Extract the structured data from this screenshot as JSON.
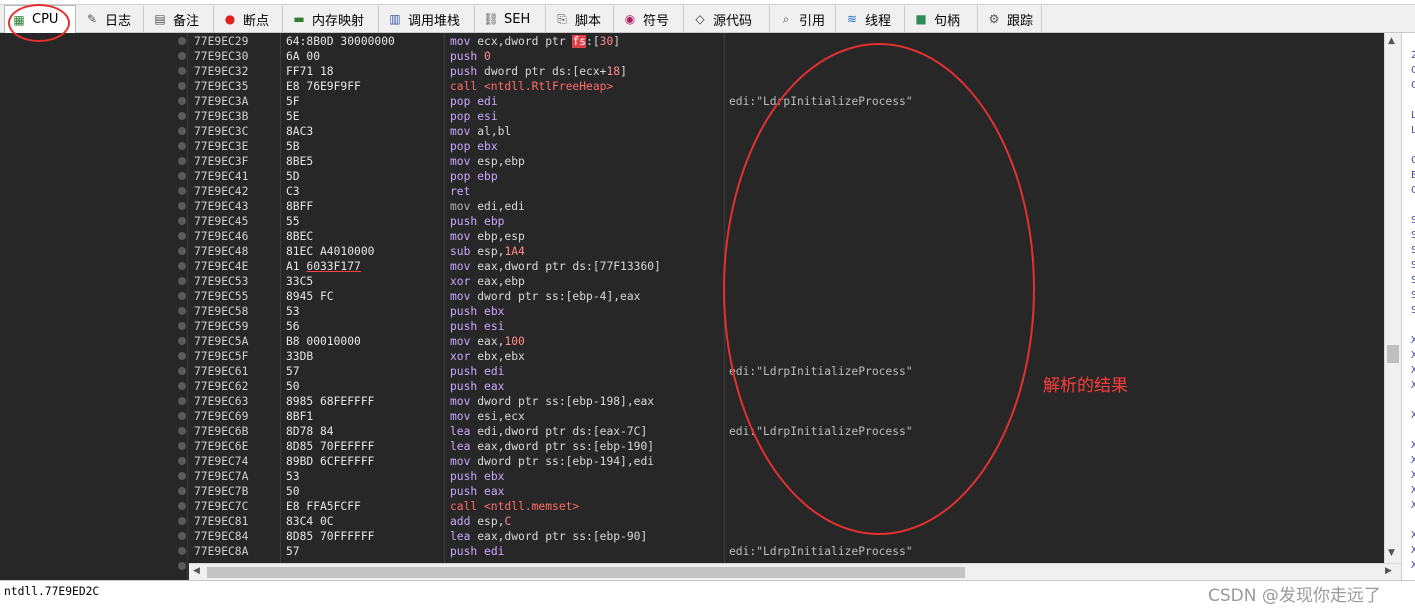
{
  "tabs": [
    {
      "label": "CPU",
      "icon": "cpu-icon",
      "active": true
    },
    {
      "label": "日志",
      "icon": "log-icon"
    },
    {
      "label": "备注",
      "icon": "notes-icon"
    },
    {
      "label": "断点",
      "icon": "breakpoint-icon"
    },
    {
      "label": "内存映射",
      "icon": "memory-map-icon"
    },
    {
      "label": "调用堆栈",
      "icon": "call-stack-icon"
    },
    {
      "label": "SEH",
      "icon": "seh-icon"
    },
    {
      "label": "脚本",
      "icon": "script-icon"
    },
    {
      "label": "符号",
      "icon": "symbols-icon"
    },
    {
      "label": "源代码",
      "icon": "source-code-icon"
    },
    {
      "label": "引用",
      "icon": "references-icon"
    },
    {
      "label": "线程",
      "icon": "threads-icon"
    },
    {
      "label": "句柄",
      "icon": "handles-icon"
    },
    {
      "label": "跟踪",
      "icon": "trace-icon"
    }
  ],
  "disasm": [
    {
      "addr": "77E9EC29",
      "bytes": "64:8B0D 30000000",
      "instr": [
        [
          "kw",
          "mov "
        ],
        [
          "plain",
          "ecx,dword ptr "
        ],
        [
          "hl",
          "fs"
        ],
        [
          "plain",
          ":["
        ],
        [
          "num",
          "30"
        ],
        [
          "plain",
          "]"
        ]
      ],
      "comment": ""
    },
    {
      "addr": "77E9EC30",
      "bytes": "6A 00",
      "instr": [
        [
          "kw",
          "push "
        ],
        [
          "num",
          "0"
        ]
      ],
      "comment": ""
    },
    {
      "addr": "77E9EC32",
      "bytes": "FF71 18",
      "instr": [
        [
          "kw",
          "push "
        ],
        [
          "plain",
          "dword ptr ds:[ecx+"
        ],
        [
          "num",
          "18"
        ],
        [
          "plain",
          "]"
        ]
      ],
      "comment": ""
    },
    {
      "addr": "77E9EC35",
      "bytes": "E8 76E9F9FF",
      "instr": [
        [
          "call",
          "call <ntdll.RtlFreeHeap>"
        ]
      ],
      "comment": ""
    },
    {
      "addr": "77E9EC3A",
      "bytes": "5F",
      "instr": [
        [
          "kw",
          "pop "
        ],
        [
          "kw",
          "edi"
        ]
      ],
      "comment": "edi:\"LdrpInitializeProcess\""
    },
    {
      "addr": "77E9EC3B",
      "bytes": "5E",
      "instr": [
        [
          "kw",
          "pop "
        ],
        [
          "kw",
          "esi"
        ]
      ],
      "comment": ""
    },
    {
      "addr": "77E9EC3C",
      "bytes": "8AC3",
      "instr": [
        [
          "kw",
          "mov "
        ],
        [
          "plain",
          "al,bl"
        ]
      ],
      "comment": ""
    },
    {
      "addr": "77E9EC3E",
      "bytes": "5B",
      "instr": [
        [
          "kw",
          "pop "
        ],
        [
          "kw",
          "ebx"
        ]
      ],
      "comment": ""
    },
    {
      "addr": "77E9EC3F",
      "bytes": "8BE5",
      "instr": [
        [
          "kw",
          "mov "
        ],
        [
          "plain",
          "esp,ebp"
        ]
      ],
      "comment": ""
    },
    {
      "addr": "77E9EC41",
      "bytes": "5D",
      "instr": [
        [
          "kw",
          "pop "
        ],
        [
          "kw",
          "ebp"
        ]
      ],
      "comment": ""
    },
    {
      "addr": "77E9EC42",
      "bytes": "C3",
      "instr": [
        [
          "kw",
          "ret"
        ]
      ],
      "comment": ""
    },
    {
      "addr": "77E9EC43",
      "bytes": "8BFF",
      "instr": [
        [
          "kwg",
          "mov "
        ],
        [
          "plain",
          "edi,edi"
        ]
      ],
      "comment": ""
    },
    {
      "addr": "77E9EC45",
      "bytes": "55",
      "instr": [
        [
          "kw",
          "push "
        ],
        [
          "kw",
          "ebp"
        ]
      ],
      "comment": ""
    },
    {
      "addr": "77E9EC46",
      "bytes": "8BEC",
      "instr": [
        [
          "kw",
          "mov "
        ],
        [
          "plain",
          "ebp,esp"
        ]
      ],
      "comment": ""
    },
    {
      "addr": "77E9EC48",
      "bytes": "81EC A4010000",
      "instr": [
        [
          "kw",
          "sub "
        ],
        [
          "plain",
          "esp,"
        ],
        [
          "num",
          "1A4"
        ]
      ],
      "comment": ""
    },
    {
      "addr": "77E9EC4E",
      "bytes": "A1 6033F177",
      "bytes_ul": true,
      "instr": [
        [
          "kw",
          "mov "
        ],
        [
          "plain",
          "eax,dword ptr ds:[77F13360]"
        ]
      ],
      "comment": ""
    },
    {
      "addr": "77E9EC53",
      "bytes": "33C5",
      "instr": [
        [
          "kw",
          "xor "
        ],
        [
          "plain",
          "eax,ebp"
        ]
      ],
      "comment": ""
    },
    {
      "addr": "77E9EC55",
      "bytes": "8945 FC",
      "instr": [
        [
          "kw",
          "mov "
        ],
        [
          "plain",
          "dword ptr ss:[ebp-4],eax"
        ]
      ],
      "comment": ""
    },
    {
      "addr": "77E9EC58",
      "bytes": "53",
      "instr": [
        [
          "kw",
          "push "
        ],
        [
          "kw",
          "ebx"
        ]
      ],
      "comment": ""
    },
    {
      "addr": "77E9EC59",
      "bytes": "56",
      "instr": [
        [
          "kw",
          "push "
        ],
        [
          "kw",
          "esi"
        ]
      ],
      "comment": ""
    },
    {
      "addr": "77E9EC5A",
      "bytes": "B8 00010000",
      "instr": [
        [
          "kw",
          "mov "
        ],
        [
          "plain",
          "eax,"
        ],
        [
          "num",
          "100"
        ]
      ],
      "comment": ""
    },
    {
      "addr": "77E9EC5F",
      "bytes": "33DB",
      "instr": [
        [
          "kw",
          "xor "
        ],
        [
          "plain",
          "ebx,ebx"
        ]
      ],
      "comment": ""
    },
    {
      "addr": "77E9EC61",
      "bytes": "57",
      "instr": [
        [
          "kw",
          "push "
        ],
        [
          "kw",
          "edi"
        ]
      ],
      "comment": "edi:\"LdrpInitializeProcess\""
    },
    {
      "addr": "77E9EC62",
      "bytes": "50",
      "instr": [
        [
          "kw",
          "push "
        ],
        [
          "kw",
          "eax"
        ]
      ],
      "comment": ""
    },
    {
      "addr": "77E9EC63",
      "bytes": "8985 68FEFFFF",
      "instr": [
        [
          "kw",
          "mov "
        ],
        [
          "plain",
          "dword ptr ss:[ebp-198],eax"
        ]
      ],
      "comment": ""
    },
    {
      "addr": "77E9EC69",
      "bytes": "8BF1",
      "instr": [
        [
          "kw",
          "mov "
        ],
        [
          "plain",
          "esi,ecx"
        ]
      ],
      "comment": ""
    },
    {
      "addr": "77E9EC6B",
      "bytes": "8D78 84",
      "instr": [
        [
          "kw",
          "lea "
        ],
        [
          "plain",
          "edi,dword ptr ds:[eax-7C]"
        ]
      ],
      "comment": "edi:\"LdrpInitializeProcess\""
    },
    {
      "addr": "77E9EC6E",
      "bytes": "8D85 70FEFFFF",
      "instr": [
        [
          "kw",
          "lea "
        ],
        [
          "plain",
          "eax,dword ptr ss:[ebp-190]"
        ]
      ],
      "comment": ""
    },
    {
      "addr": "77E9EC74",
      "bytes": "89BD 6CFEFFFF",
      "instr": [
        [
          "kw",
          "mov "
        ],
        [
          "plain",
          "dword ptr ss:[ebp-194],edi"
        ]
      ],
      "comment": ""
    },
    {
      "addr": "77E9EC7A",
      "bytes": "53",
      "instr": [
        [
          "kw",
          "push "
        ],
        [
          "kw",
          "ebx"
        ]
      ],
      "comment": ""
    },
    {
      "addr": "77E9EC7B",
      "bytes": "50",
      "instr": [
        [
          "kw",
          "push "
        ],
        [
          "kw",
          "eax"
        ]
      ],
      "comment": ""
    },
    {
      "addr": "77E9EC7C",
      "bytes": "E8 FFA5FCFF",
      "instr": [
        [
          "call",
          "call <ntdll.memset>"
        ]
      ],
      "comment": ""
    },
    {
      "addr": "77E9EC81",
      "bytes": "83C4 0C",
      "instr": [
        [
          "kw",
          "add "
        ],
        [
          "plain",
          "esp,"
        ],
        [
          "num",
          "C"
        ]
      ],
      "comment": ""
    },
    {
      "addr": "77E9EC84",
      "bytes": "8D85 70FFFFFF",
      "instr": [
        [
          "kw",
          "lea "
        ],
        [
          "plain",
          "eax,dword ptr ss:[ebp-90]"
        ]
      ],
      "comment": ""
    },
    {
      "addr": "77E9EC8A",
      "bytes": "57",
      "instr": [
        [
          "kw",
          "push "
        ],
        [
          "kw",
          "edi"
        ]
      ],
      "comment": "edi:\"LdrpInitializeProcess\""
    }
  ],
  "right_strip_chars": [
    "2",
    "C",
    "C",
    "",
    "L",
    "L",
    "",
    "C",
    "E",
    "C",
    "",
    "S",
    "S",
    "S",
    "S",
    "S",
    "S",
    "S",
    "",
    "X",
    "X",
    "X",
    "X",
    "",
    "X",
    "",
    "X",
    "X",
    "X",
    "X",
    "X",
    "",
    "X",
    "X",
    "X"
  ],
  "status_text": "ntdll.77E9ED2C",
  "watermark": "CSDN @发现你走远了",
  "annotation_label": "解析的结果",
  "colors": {
    "highlight": "#e0424a",
    "annotation": "#e53030",
    "background": "#272727"
  }
}
